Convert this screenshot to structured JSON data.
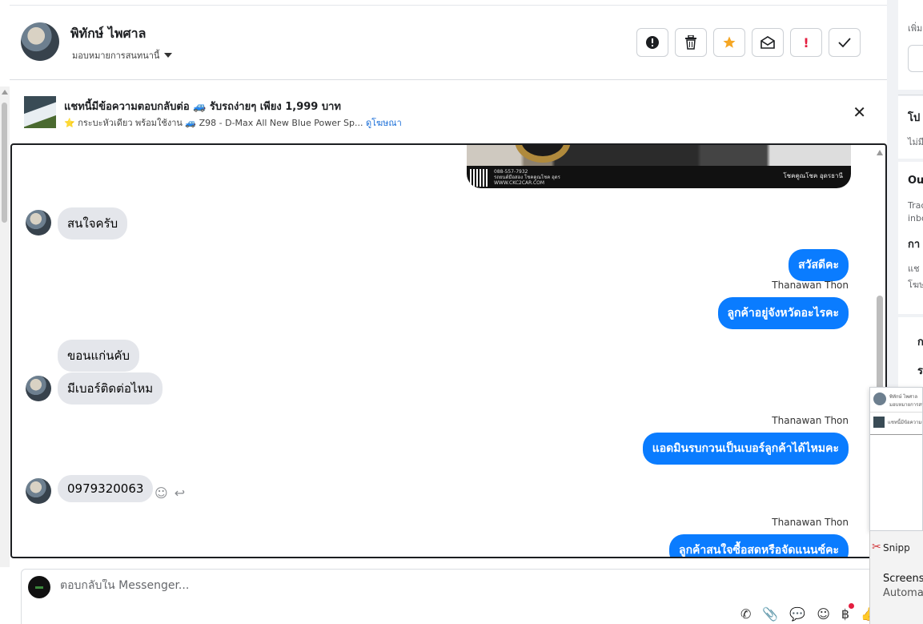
{
  "header": {
    "contact_name": "พิทักษ์ ไพศาล",
    "assign_label": "มอบหมายการสนทนานี้",
    "actions": [
      "!",
      "🗑",
      "★",
      "✉",
      "!",
      "✓"
    ]
  },
  "ad": {
    "title": "แชทนี้มีข้อความตอบกลับต่อ 🚙 รับรถง่ายๆ เพียง 1,999 บาท",
    "subtitle": "⭐ กระบะหัวเดียว พร้อมใช้งาน 🚙 Z98 - D-Max All New Blue Power Sp...",
    "link": "ดูโฆษณา",
    "close": "✕"
  },
  "image_message": {
    "info_lines": [
      "088-557-7932",
      "รถยนต์มือสอง โชคคูณโชค อุดร",
      "WWW.CKC2CAR.COM"
    ],
    "brand": "โชคคูณโชค อุดรธานี"
  },
  "messages": [
    {
      "side": "in",
      "text": "สนใจครับ"
    },
    {
      "side": "out",
      "text": "สวัสดีคะ"
    },
    {
      "side": "out",
      "sender": "Thanawan Thon",
      "text": "ลูกค้าอยู่จังหวัดอะไรคะ"
    },
    {
      "side": "in",
      "text": "ขอนแก่นคับ"
    },
    {
      "side": "in",
      "text": "มีเบอร์ติดต่อไหม"
    },
    {
      "side": "out",
      "sender": "Thanawan Thon",
      "text": "แอดมินรบกวนเป็นเบอร์ลูกค้าได้ไหมคะ"
    },
    {
      "side": "in",
      "text": "0979320063"
    },
    {
      "side": "out",
      "sender": "Thanawan Thon",
      "text": "ลูกค้าสนใจซื้อสดหรือจัดแนนซ์คะ"
    }
  ],
  "composer": {
    "placeholder": "ตอบกลับใน Messenger..."
  },
  "right_panel": {
    "sections": [
      "เพิ่ม",
      "โป",
      "ไม่มี",
      "Ou",
      "Trac",
      "inbo",
      "กา",
      "แช",
      "โฆษ",
      "ก",
      "ร"
    ]
  },
  "popup": {
    "line1": "พิทักษ์ ไพศาล",
    "line2": "มอบหมายการสนทนานี้",
    "line3": "แชทนี้มีข้อความตอบกลับต่อ"
  },
  "snip": {
    "app": "Snipp",
    "title": "Screensh",
    "sub": "Automat"
  }
}
